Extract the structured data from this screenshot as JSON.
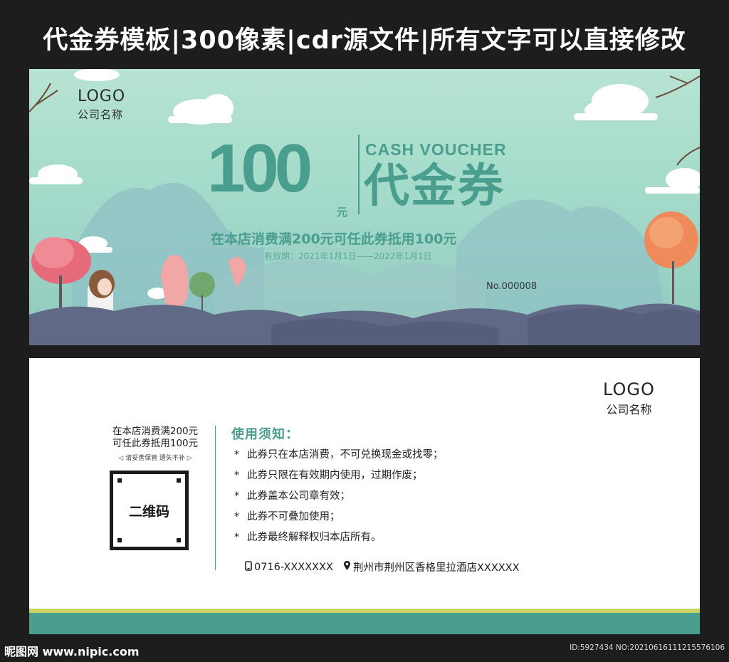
{
  "page_title": "代金券模板|300像素|cdr源文件|所有文字可以直接修改",
  "front": {
    "logo": "LOGO",
    "company_name": "公司名称",
    "amount": "100",
    "unit": "元",
    "cash_voucher": "CASH VOUCHER",
    "voucher_title": "代金券",
    "condition": "在本店消费满200元可任此券抵用100元",
    "validity": "有效期：2021年1月1日——2022年1月1日",
    "serial": "No.000008"
  },
  "back": {
    "logo": "LOGO",
    "company_name": "公司名称",
    "stub_line1": "在本店消费满200元",
    "stub_line2": "可任此券抵用100元",
    "stub_note": "◁ 请妥善保管  遗失不补 ▷",
    "qr_label": "二维码",
    "notice_title": "使用须知：",
    "notices": [
      "此券只在本店消费，不可兑换现金或找零；",
      "此券只限在有效期内使用，过期作废；",
      "此券盖本公司章有效；",
      "此券不可叠加使用；",
      "此券最终解释权归本店所有。"
    ],
    "phone": "0716-XXXXXXX",
    "address": "荆州市荆州区香格里拉酒店XXXXXX"
  },
  "watermark": {
    "brand": "昵图网 www.nipic.com",
    "id_text": "ID:5927434 NO:20210616111215576106"
  },
  "colors": {
    "accent": "#4a9e8e",
    "band_yellow": "#ccd35e",
    "background": "#1d1d1d"
  }
}
